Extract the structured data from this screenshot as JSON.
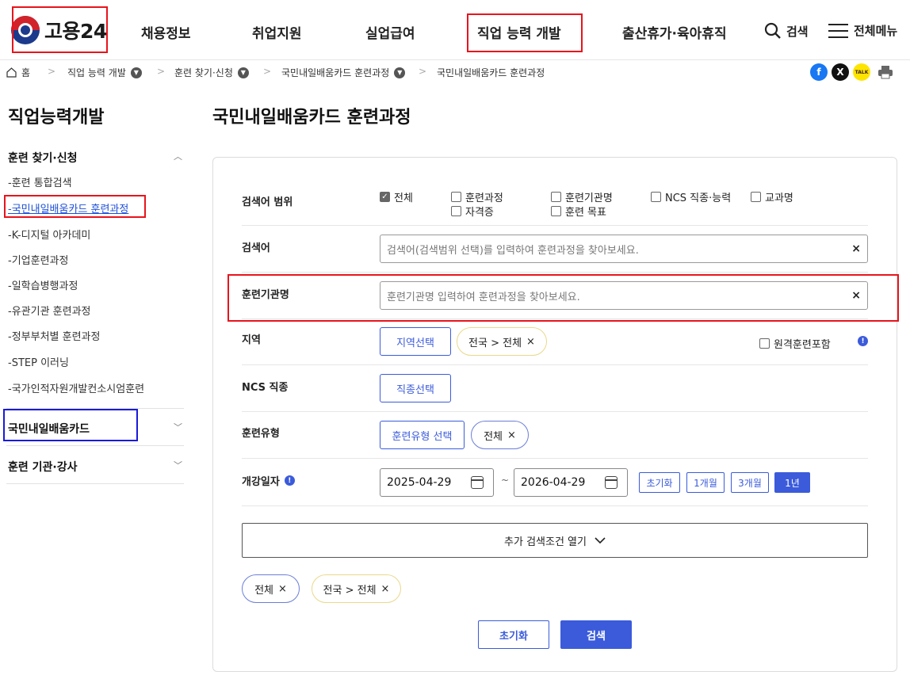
{
  "header": {
    "logo_text": "고용24",
    "nav": [
      "채용정보",
      "취업지원",
      "실업급여",
      "직업 능력 개발",
      "출산휴가·육아휴직"
    ],
    "search_label": "검색",
    "menu_label": "전체메뉴"
  },
  "breadcrumb": {
    "home": "홈",
    "items": [
      "직업 능력 개발",
      "훈련 찾기·신청",
      "국민내일배움카드 훈련과정",
      "국민내일배움카드 훈련과정"
    ]
  },
  "share": {
    "facebook": "f",
    "x": "X",
    "kakao": "TALK"
  },
  "sidebar": {
    "title": "직업능력개발",
    "group1": "훈련 찾기·신청",
    "items": [
      "-훈련 통합검색",
      "-국민내일배움카드 훈련과정",
      "-K-디지털 아카데미",
      "-기업훈련과정",
      "-일학습병행과정",
      "-유관기관 훈련과정",
      "-정부부처별 훈련과정",
      "-STEP 이러닝",
      "-국가인적자원개발컨소시엄훈련"
    ],
    "group2": "국민내일배움카드",
    "group3": "훈련 기관·강사"
  },
  "main": {
    "title": "국민내일배움카드 훈련과정",
    "scope_label": "검색어 범위",
    "scope_options": [
      {
        "label": "전체",
        "checked": true
      },
      {
        "label": "훈련과정",
        "checked": false
      },
      {
        "label": "훈련기관명",
        "checked": false
      },
      {
        "label": "NCS 직종·능력",
        "checked": false
      },
      {
        "label": "교과명",
        "checked": false
      },
      {
        "label": "자격증",
        "checked": false
      },
      {
        "label": "훈련 목표",
        "checked": false
      }
    ],
    "keyword_label": "검색어",
    "keyword_placeholder": "검색어(검색범위 선택)를 입력하여 훈련과정을 찾아보세요.",
    "org_label": "훈련기관명",
    "org_placeholder": "훈련기관명 입력하여 훈련과정을 찾아보세요.",
    "region_label": "지역",
    "region_button": "지역선택",
    "region_chip": "전국 > 전체",
    "remote_label": "원격훈련포함",
    "ncs_label": "NCS 직종",
    "ncs_button": "직종선택",
    "type_label": "훈련유형",
    "type_button": "훈련유형 선택",
    "type_chip": "전체",
    "date_label": "개강일자",
    "date_from": "2025-04-29",
    "date_sep": "~",
    "date_to": "2026-04-29",
    "quick": [
      "초기화",
      "1개월",
      "3개월",
      "1년"
    ],
    "more_label": "추가 검색조건 열기",
    "chips": [
      "전체",
      "전국 > 전체"
    ],
    "reset_button": "초기화",
    "search_button": "검색",
    "clear_symbol": "×"
  }
}
